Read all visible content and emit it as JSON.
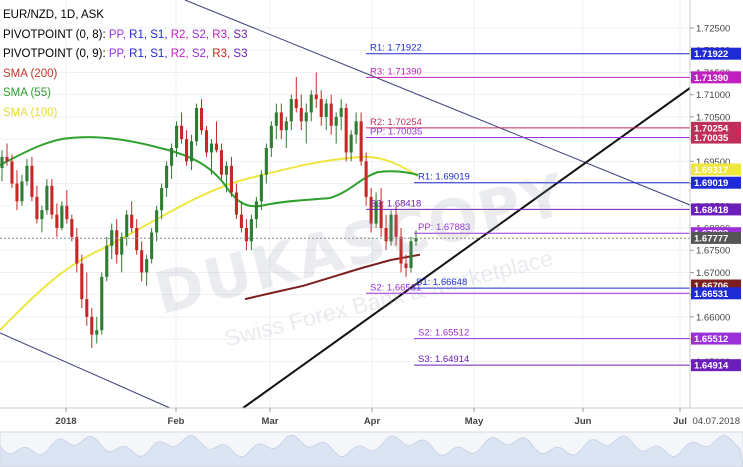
{
  "legend": {
    "symbol": "EUR/NZD, 1D, ASK",
    "pivot1": {
      "prefix": "PIVOTPOINT (0, 8):",
      "items": [
        "PP,",
        "R1,",
        "S1,",
        "R2,",
        "S2,",
        "R3,",
        "S3"
      ]
    },
    "pivot2": {
      "prefix": "PIVOTPOINT (0, 9):",
      "items": [
        "PP,",
        "R1,",
        "S1,",
        "R2,",
        "S2,",
        "R3,",
        "S3"
      ]
    },
    "sma200": "SMA (200)",
    "sma55": "SMA (55)",
    "sma100": "SMA (100)"
  },
  "watermark": {
    "main": "DUKASCOPY",
    "sub": "Swiss Forex Bank & Marketplace"
  },
  "date_stamp": "04.07.2018",
  "colors": {
    "up": "#2e7d32",
    "down": "#c62828",
    "sma200": "#7b1f1f",
    "sma55": "#2ea02e",
    "sma100": "#f0e640",
    "pp": "#9b30d9",
    "r1": "#1e2bd4",
    "s1": "#1e2bd4",
    "r2": "#c02f5a",
    "s2": "#9b30d9",
    "r3": "#c21fbf",
    "s3": "#6b1fb8",
    "trend": "#111111",
    "channel": "#3a3f7a"
  },
  "chart_data": {
    "type": "candlestick",
    "instrument": "EUR/NZD",
    "timeframe": "1D",
    "ylim": [
      1.6395,
      1.7295
    ],
    "y_ticks": [
      "1.72500",
      "1.72000",
      "1.71500",
      "1.71000",
      "1.70500",
      "1.70000",
      "1.69500",
      "1.69000",
      "1.68500",
      "1.68000",
      "1.67500",
      "1.67000",
      "1.66500",
      "1.66000",
      "1.65500",
      "1.65000"
    ],
    "x_ticks": [
      "2018",
      "Feb",
      "Mar",
      "Apr",
      "May",
      "Jun",
      "Jul"
    ],
    "candles": [
      [
        1.6935,
        1.6975,
        1.6905,
        1.696
      ],
      [
        1.696,
        1.699,
        1.694,
        1.695
      ],
      [
        1.695,
        1.6965,
        1.689,
        1.69
      ],
      [
        1.69,
        1.693,
        1.684,
        1.686
      ],
      [
        1.686,
        1.692,
        1.685,
        1.6905
      ],
      [
        1.6905,
        1.6955,
        1.6895,
        1.694
      ],
      [
        1.694,
        1.696,
        1.686,
        1.687
      ],
      [
        1.687,
        1.6895,
        1.681,
        1.682
      ],
      [
        1.682,
        1.685,
        1.679,
        1.684
      ],
      [
        1.684,
        1.691,
        1.683,
        1.6895
      ],
      [
        1.6895,
        1.691,
        1.682,
        1.683
      ],
      [
        1.683,
        1.6855,
        1.678,
        1.68
      ],
      [
        1.68,
        1.686,
        1.6795,
        1.685
      ],
      [
        1.685,
        1.6885,
        1.681,
        1.682
      ],
      [
        1.682,
        1.683,
        1.677,
        1.678
      ],
      [
        1.678,
        1.68,
        1.67,
        1.672
      ],
      [
        1.672,
        1.674,
        1.662,
        1.664
      ],
      [
        1.664,
        1.67,
        1.658,
        1.66
      ],
      [
        1.66,
        1.662,
        1.653,
        1.656
      ],
      [
        1.656,
        1.66,
        1.654,
        1.657
      ],
      [
        1.657,
        1.67,
        1.656,
        1.669
      ],
      [
        1.669,
        1.678,
        1.668,
        1.676
      ],
      [
        1.676,
        1.681,
        1.673,
        1.6795
      ],
      [
        1.6795,
        1.682,
        1.672,
        1.674
      ],
      [
        1.674,
        1.679,
        1.67,
        1.678
      ],
      [
        1.678,
        1.684,
        1.676,
        1.683
      ],
      [
        1.683,
        1.686,
        1.679,
        1.68
      ],
      [
        1.68,
        1.682,
        1.674,
        1.675
      ],
      [
        1.675,
        1.677,
        1.668,
        1.67
      ],
      [
        1.67,
        1.674,
        1.667,
        1.673
      ],
      [
        1.673,
        1.68,
        1.672,
        1.679
      ],
      [
        1.679,
        1.685,
        1.677,
        1.684
      ],
      [
        1.684,
        1.69,
        1.682,
        1.689
      ],
      [
        1.689,
        1.695,
        1.687,
        1.694
      ],
      [
        1.694,
        1.699,
        1.691,
        1.698
      ],
      [
        1.698,
        1.704,
        1.696,
        1.703
      ],
      [
        1.703,
        1.706,
        1.699,
        1.7
      ],
      [
        1.7,
        1.702,
        1.694,
        1.695
      ],
      [
        1.695,
        1.701,
        1.693,
        1.6995
      ],
      [
        1.6995,
        1.708,
        1.6985,
        1.707
      ],
      [
        1.707,
        1.709,
        1.701,
        1.702
      ],
      [
        1.702,
        1.703,
        1.696,
        1.697
      ],
      [
        1.697,
        1.7,
        1.692,
        1.699
      ],
      [
        1.699,
        1.704,
        1.697,
        1.6975
      ],
      [
        1.6975,
        1.699,
        1.691,
        1.692
      ],
      [
        1.692,
        1.695,
        1.688,
        1.694
      ],
      [
        1.694,
        1.696,
        1.687,
        1.688
      ],
      [
        1.688,
        1.69,
        1.682,
        1.683
      ],
      [
        1.683,
        1.686,
        1.679,
        1.68
      ],
      [
        1.68,
        1.682,
        1.675,
        1.677
      ],
      [
        1.677,
        1.683,
        1.675,
        1.682
      ],
      [
        1.682,
        1.687,
        1.68,
        1.686
      ],
      [
        1.686,
        1.693,
        1.684,
        1.692
      ],
      [
        1.692,
        1.699,
        1.69,
        1.698
      ],
      [
        1.698,
        1.704,
        1.696,
        1.703
      ],
      [
        1.703,
        1.708,
        1.7,
        1.706
      ],
      [
        1.706,
        1.708,
        1.7,
        1.702
      ],
      [
        1.702,
        1.705,
        1.698,
        1.704
      ],
      [
        1.704,
        1.71,
        1.702,
        1.709
      ],
      [
        1.709,
        1.714,
        1.706,
        1.707
      ],
      [
        1.707,
        1.71,
        1.702,
        1.704
      ],
      [
        1.704,
        1.708,
        1.699,
        1.706
      ],
      [
        1.706,
        1.711,
        1.704,
        1.71
      ],
      [
        1.71,
        1.715,
        1.707,
        1.709
      ],
      [
        1.709,
        1.711,
        1.703,
        1.705
      ],
      [
        1.705,
        1.709,
        1.702,
        1.708
      ],
      [
        1.708,
        1.71,
        1.701,
        1.703
      ],
      [
        1.703,
        1.706,
        1.699,
        1.705
      ],
      [
        1.705,
        1.709,
        1.702,
        1.707
      ],
      [
        1.707,
        1.708,
        1.695,
        1.697
      ],
      [
        1.697,
        1.702,
        1.695,
        1.701
      ],
      [
        1.701,
        1.706,
        1.699,
        1.704
      ],
      [
        1.704,
        1.706,
        1.694,
        1.695
      ],
      [
        1.695,
        1.697,
        1.685,
        1.687
      ],
      [
        1.687,
        1.689,
        1.679,
        1.681
      ],
      [
        1.681,
        1.688,
        1.68,
        1.686
      ],
      [
        1.686,
        1.689,
        1.678,
        1.68
      ],
      [
        1.68,
        1.683,
        1.675,
        1.677
      ],
      [
        1.677,
        1.684,
        1.676,
        1.683
      ],
      [
        1.683,
        1.685,
        1.676,
        1.678
      ],
      [
        1.678,
        1.68,
        1.67,
        1.672
      ],
      [
        1.672,
        1.674,
        1.669,
        1.671
      ],
      [
        1.671,
        1.678,
        1.67,
        1.677
      ],
      [
        1.677,
        1.6795,
        1.676,
        1.6777
      ]
    ],
    "sma200": [
      1.664,
      1.6655,
      1.667,
      1.669,
      1.671,
      1.6728,
      1.674
    ],
    "sma55_end": 1.6932,
    "pivots_current": [
      {
        "key": "r1",
        "label": "R1: 1.71922",
        "value": 1.71922
      },
      {
        "key": "r3",
        "label": "R3: 1.71390",
        "value": 1.7139
      },
      {
        "key": "r2",
        "label": "R2: 1.70254",
        "value": 1.70254
      },
      {
        "key": "pp",
        "label": "PP: 1.70035",
        "value": 1.70035
      },
      {
        "key": "s3",
        "label": "S3: 1.68418",
        "value": 1.68418
      },
      {
        "key": "s2",
        "label": "S2: 1.66531",
        "value": 1.66531
      }
    ],
    "pivots_next": [
      {
        "key": "r1",
        "label": "R1: 1.69019",
        "value": 1.69019
      },
      {
        "key": "pp",
        "label": "PP: 1.67883",
        "value": 1.67883
      },
      {
        "key": "s1",
        "label": "S1: 1.66648",
        "value": 1.66648
      },
      {
        "key": "s2",
        "label": "S2: 1.65512",
        "value": 1.65512
      },
      {
        "key": "s3",
        "label": "S3: 1.64914",
        "value": 1.64914
      }
    ],
    "price_tags": [
      {
        "value": 1.71922,
        "label": "1.71922",
        "key": "r1"
      },
      {
        "value": 1.7139,
        "label": "1.71390",
        "key": "r3"
      },
      {
        "value": 1.70254,
        "label": "1.70254",
        "key": "r2"
      },
      {
        "value": 1.70035,
        "label": "1.70035",
        "key": "r2"
      },
      {
        "value": 1.69317,
        "label": "1.69317",
        "key": "sma100"
      },
      {
        "value": 1.69019,
        "label": "1.69019",
        "key": "r1"
      },
      {
        "value": 1.68418,
        "label": "1.68418",
        "key": "s3"
      },
      {
        "value": 1.67883,
        "label": "1.67883",
        "key": "pp"
      },
      {
        "value": 1.67777,
        "label": "1.67777",
        "key": "price"
      },
      {
        "value": 1.66706,
        "label": "1.66706",
        "key": "sma200"
      },
      {
        "value": 1.66531,
        "label": "1.66531",
        "key": "s1"
      },
      {
        "value": 1.65512,
        "label": "1.65512",
        "key": "s2"
      },
      {
        "value": 1.64914,
        "label": "1.64914",
        "key": "s3"
      }
    ]
  }
}
